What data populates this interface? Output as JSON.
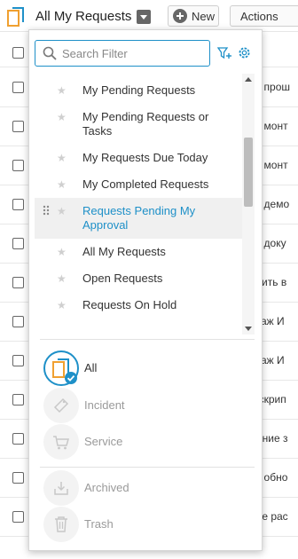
{
  "toolbar": {
    "title": "All My Requests",
    "new_label": "New",
    "actions_label": "Actions"
  },
  "background_rows": [
    "ти прош",
    "ти монт",
    "ти монт",
    "ти демо",
    "ти доку",
    "овить в",
    "нтаж И",
    "нтаж И",
    "ь скрип",
    "ление з",
    "ка обно",
    "ние рас"
  ],
  "search": {
    "placeholder": "Search Filter",
    "value": ""
  },
  "filters": [
    {
      "label": "My Pending Requests"
    },
    {
      "label": "My Pending Requests or Tasks"
    },
    {
      "label": "My Requests Due Today"
    },
    {
      "label": "My Completed Requests"
    },
    {
      "label": "Requests Pending My Approval",
      "selected": true
    },
    {
      "label": "All My Requests"
    },
    {
      "label": "Open Requests"
    },
    {
      "label": "Requests On Hold"
    }
  ],
  "categories": [
    {
      "label": "All",
      "icon": "all-requests-icon",
      "active": true
    },
    {
      "label": "Incident",
      "icon": "incident-ticket-icon"
    },
    {
      "label": "Service",
      "icon": "shopping-cart-icon"
    }
  ],
  "archive_categories": [
    {
      "label": "Archived",
      "icon": "archive-icon"
    },
    {
      "label": "Trash",
      "icon": "trash-icon"
    }
  ],
  "colors": {
    "accent": "#1e90c8",
    "app_icon": "#f0a030",
    "muted_text": "#9a9a9a"
  }
}
